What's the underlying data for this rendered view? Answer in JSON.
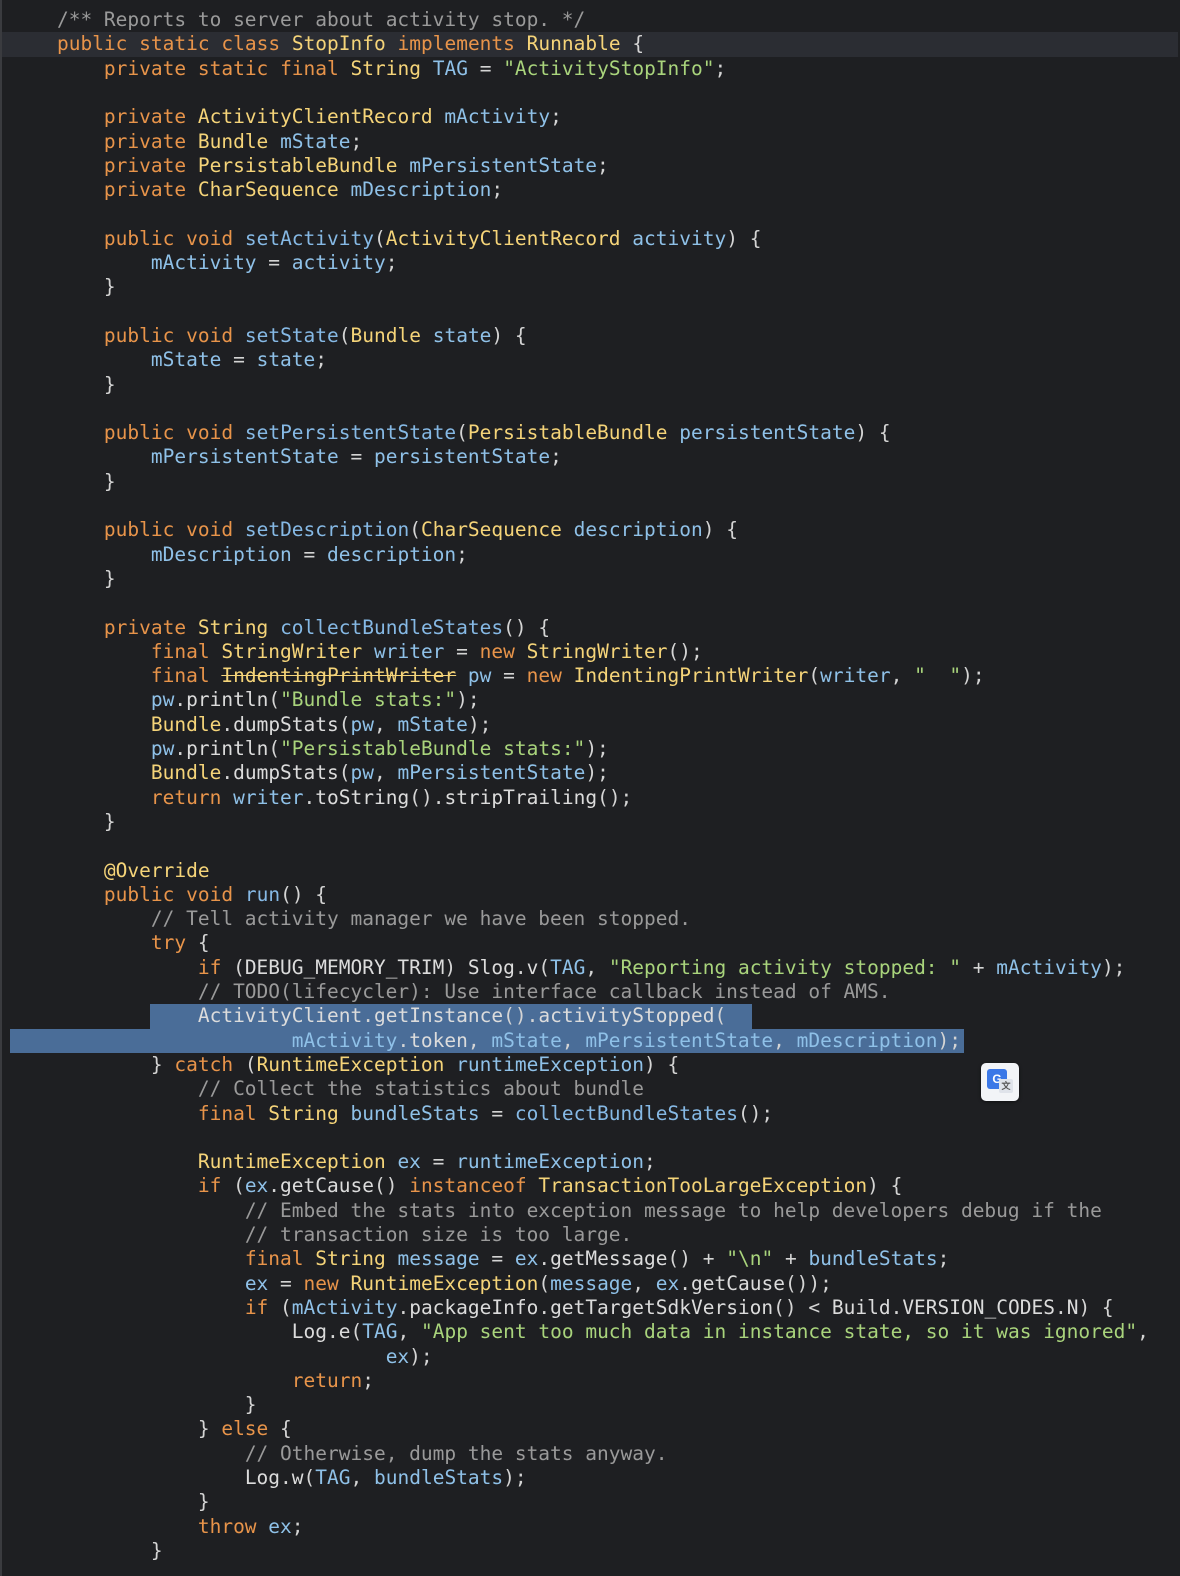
{
  "editor": {
    "lines": [
      "    /** Reports to server about activity stop. */",
      "    public static class StopInfo implements Runnable {",
      "        private static final String TAG = \"ActivityStopInfo\";",
      "",
      "        private ActivityClientRecord mActivity;",
      "        private Bundle mState;",
      "        private PersistableBundle mPersistentState;",
      "        private CharSequence mDescription;",
      "",
      "        public void setActivity(ActivityClientRecord activity) {",
      "            mActivity = activity;",
      "        }",
      "",
      "        public void setState(Bundle state) {",
      "            mState = state;",
      "        }",
      "",
      "        public void setPersistentState(PersistableBundle persistentState) {",
      "            mPersistentState = persistentState;",
      "        }",
      "",
      "        public void setDescription(CharSequence description) {",
      "            mDescription = description;",
      "        }",
      "",
      "        private String collectBundleStates() {",
      "            final StringWriter writer = new StringWriter();",
      "            final IndentingPrintWriter pw = new IndentingPrintWriter(writer, \"  \");",
      "            pw.println(\"Bundle stats:\");",
      "            Bundle.dumpStats(pw, mState);",
      "            pw.println(\"PersistableBundle stats:\");",
      "            Bundle.dumpStats(pw, mPersistentState);",
      "            return writer.toString().stripTrailing();",
      "        }",
      "",
      "        @Override",
      "        public void run() {",
      "            // Tell activity manager we have been stopped.",
      "            try {",
      "                if (DEBUG_MEMORY_TRIM) Slog.v(TAG, \"Reporting activity stopped: \" + mActivity);",
      "                // TODO(lifecycler): Use interface callback instead of AMS.",
      "                ActivityClient.getInstance().activityStopped(",
      "                        mActivity.token, mState, mPersistentState, mDescription);",
      "            } catch (RuntimeException runtimeException) {",
      "                // Collect the statistics about bundle",
      "                final String bundleStats = collectBundleStates();",
      "",
      "                RuntimeException ex = runtimeException;",
      "                if (ex.getCause() instanceof TransactionTooLargeException) {",
      "                    // Embed the stats into exception message to help developers debug if the",
      "                    // transaction size is too large.",
      "                    final String message = ex.getMessage() + \"\\n\" + bundleStats;",
      "                    ex = new RuntimeException(message, ex.getCause());",
      "                    if (mActivity.packageInfo.getTargetSdkVersion() < Build.VERSION_CODES.N) {",
      "                        Log.e(TAG, \"App sent too much data in instance state, so it was ignored\",",
      "                                ex);",
      "                        return;",
      "                    }",
      "                } else {",
      "                    // Otherwise, dump the stats anyway.",
      "                    Log.w(TAG, bundleStats);",
      "                }",
      "                throw ex;",
      "            }"
    ],
    "current_line_index": 1,
    "selected_line_indices": [
      41,
      42
    ]
  },
  "translate_badge": {
    "icon": "google-translate-icon"
  }
}
